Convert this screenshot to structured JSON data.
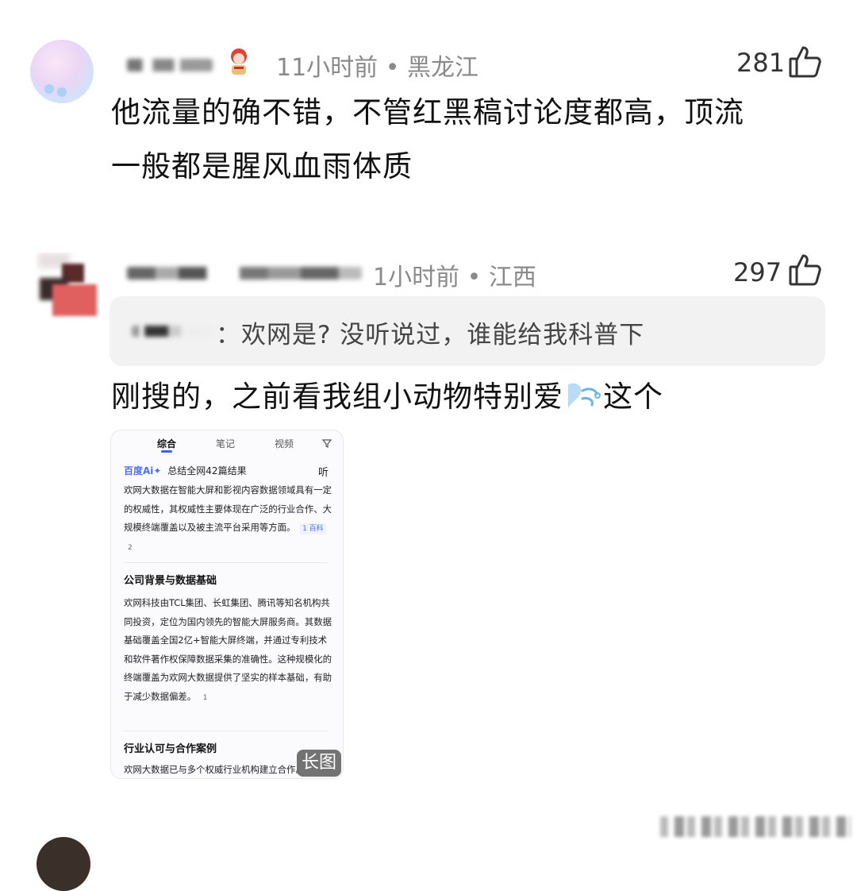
{
  "comments": [
    {
      "meta": "11小时前 • 黑龙江",
      "likes": "281",
      "text_line1": "他流量的确不错，不管红黑稿讨论度都高，顶流",
      "text_line2": "一般都是腥风血雨体质"
    },
    {
      "meta": "1小时前 • 江西",
      "likes": "297",
      "quote": "：欢网是? 没听说过，谁能给我科普下",
      "text": "刚搜的，之前看我组小动物特别爱",
      "text_suffix": "这个",
      "screenshot": {
        "tabs": [
          "综合",
          "笔记",
          "视频"
        ],
        "ai_logo": "百度Ai✦",
        "ai_summary": "总结全网42篇结果",
        "listen": "听",
        "para1": "欢网大数据在智能大屏和影视内容数据领域具有一定的权威性，其权威性主要体现在广泛的行业合作、大规模终端覆盖以及被主流平台采用等方面。",
        "para1_cite1": "1 百科",
        "para1_cite2": "2",
        "section1_title": "公司背景与数据基础",
        "para2": "欢网科技由TCL集团、长虹集团、腾讯等知名机构共同投资，定位为国内领先的智能大屏服务商。其数据基础覆盖全国2亿+智能大屏终端，并通过专利技术和软件著作权保障数据采集的准确性。这种规模化的终端覆盖为欢网大数据提供了坚实的样本基础，有助于减少数据偏差。",
        "para2_cite": "1",
        "section2_title": "行业认可与合作案例",
        "para3": "欢网大数据已与多个权威行业机构建立合作。",
        "long_badge": "长图"
      }
    }
  ],
  "colors": {
    "meta_gray": "#8a8a8a",
    "quote_bg": "#f2f2f2",
    "baidu_blue": "#4e6ef2"
  },
  "icons": [
    "thumbs-up-icon",
    "filter-icon",
    "wind-emoji-icon"
  ]
}
